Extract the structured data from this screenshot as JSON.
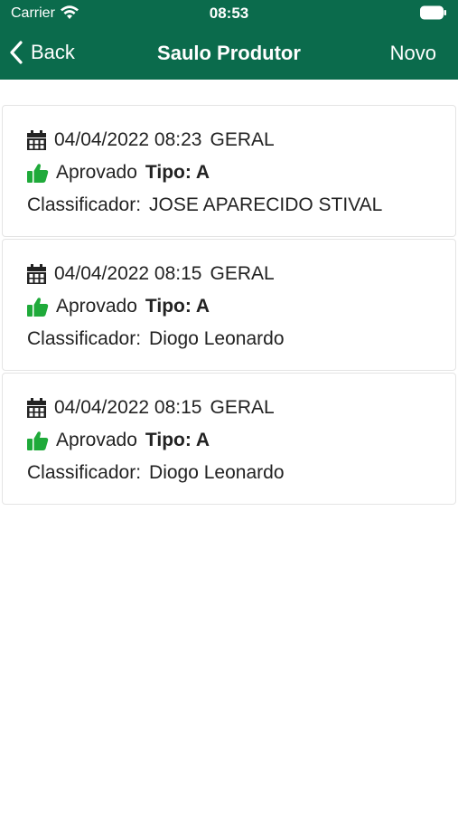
{
  "status_bar": {
    "carrier": "Carrier",
    "time": "08:53"
  },
  "nav": {
    "back_label": "Back",
    "title": "Saulo Produtor",
    "action_label": "Novo"
  },
  "colors": {
    "header_bg": "#0b6b4c",
    "approved_icon": "#1faa3a"
  },
  "records": [
    {
      "datetime": "04/04/2022 08:23",
      "category": "GERAL",
      "status": "Aprovado",
      "type_label": "Tipo: A",
      "classifier_label": "Classificador:",
      "classifier_name": "JOSE APARECIDO STIVAL"
    },
    {
      "datetime": "04/04/2022 08:15",
      "category": "GERAL",
      "status": "Aprovado",
      "type_label": "Tipo: A",
      "classifier_label": "Classificador:",
      "classifier_name": "Diogo Leonardo"
    },
    {
      "datetime": "04/04/2022 08:15",
      "category": "GERAL",
      "status": "Aprovado",
      "type_label": "Tipo: A",
      "classifier_label": "Classificador:",
      "classifier_name": "Diogo Leonardo"
    }
  ]
}
